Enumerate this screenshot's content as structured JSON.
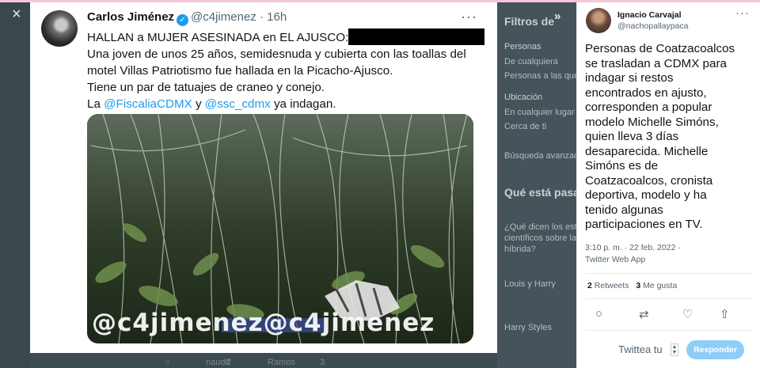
{
  "tweet": {
    "author": "Carlos Jiménez",
    "handle": "@c4jimenez",
    "time": "· 16h",
    "more": "···",
    "headline": "HALLAN a MUJER ASESINADA en EL AJUSCO:",
    "lines": [
      "Una joven de unos 25 años, semidesnuda y cubierta con las toallas del",
      "motel Villas Patriotismo fue hallada en la Picacho-Ajusco.",
      "Tiene un par de tatuajes de craneo y conejo."
    ],
    "last_prefix": "La ",
    "mention1": "@FiscaliaCDMX",
    "joiner": " y ",
    "mention2": "@ssc_cdmx",
    "last_suffix": " ya indagan.",
    "watermark": "@c4jimenez@c4jimenez"
  },
  "background": {
    "sidebar": {
      "filters_title": "Filtros de",
      "people_label": "Personas",
      "people_opt1": "De cualquiera",
      "people_opt2": "Personas a las que sig",
      "location_label": "Ubicación",
      "location_opt1": "En cualquier lugar",
      "location_opt2": "Cerca de ti",
      "advanced": "Búsqueda avanzada",
      "trends_title": "Qué está pasa",
      "trend1_l1": "¿Qué dicen los estu",
      "trend1_l2": "científicos sobre la",
      "trend1_l3": "híbrida?",
      "trend2": "Louis y Harry",
      "trend3": "Harry Styles"
    },
    "feed_bottom": {
      "a": "naudtl",
      "b": "2",
      "c": "Ramos",
      "d": "3"
    }
  },
  "reply": {
    "author": "Ignacio Carvajal",
    "handle": "@nachopallaypaca",
    "more": "···",
    "lines": [
      "Personas de Coatzacoalcos",
      "se trasladan a CDMX para",
      "indagar si restos",
      "encontrados en ajusto,",
      "corresponden a popular",
      "modelo Michelle Simóns,",
      "quien lleva 3 días",
      "desaparecida. Michelle",
      "Simóns es de",
      "Coatzacoalcos, cronista",
      "deportiva, modelo y ha",
      "tenido algunas",
      "participaciones en TV."
    ],
    "timestamp": "3:10 p. m. · 22 feb. 2022 ·",
    "source": "Twitter Web App",
    "retweets_count": "2",
    "retweets_label": "Retweets",
    "likes_count": "3",
    "likes_label": "Me gusta",
    "reply_placeholder": "Twittea tu",
    "reply_button": "Responder"
  },
  "icons": {
    "close": "×",
    "expand": "»",
    "reply": "○",
    "retweet": "⇄",
    "like": "♡",
    "share": "⇧"
  },
  "colors": {
    "accent": "#1d9bf0",
    "button_disabled": "#8ecdf8"
  }
}
